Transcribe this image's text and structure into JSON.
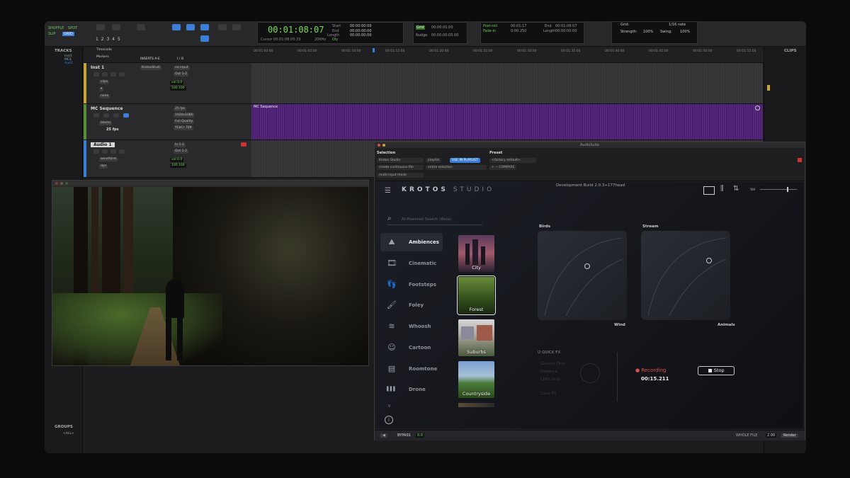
{
  "toolbar": {
    "mode": [
      "SHUFFLE",
      "SPOT",
      "SLIP",
      "GRID"
    ],
    "nums": "1 2 3 4 5",
    "main_counter": "00:01:08:07",
    "cursor_label": "Cursor",
    "cursor_value": "00:01:08:00.33",
    "sample_rate": "20KHz",
    "dly_label": "Dly",
    "start_label": "Start",
    "end_label": "End",
    "length_label": "Length",
    "start_value": "00:00:00:00",
    "end_value": "00:00:00:00",
    "length_value": "00:00:00:00",
    "grid_value": "00:00:01:00",
    "nudge_label": "Nudge",
    "nudge_value": "00:00:00:05.00",
    "preroll_label": "Post-roll",
    "fadein_label": "Fade-in",
    "pre_start": "00:01:17",
    "pre_end": "00:01:08:07",
    "post_value": "0:00.250",
    "strength_label": "Strength:",
    "strength_value": "100%",
    "swing_label": "Swing:",
    "swing_value": "100%",
    "grid_label": "Grid:",
    "grid_note": "1/16 note"
  },
  "tracks_panel": {
    "title": "TRACKS",
    "items": [
      "Inst1",
      "MC4",
      "Aud1"
    ],
    "groups_title": "GROUPS",
    "groups_all": "<ALL>"
  },
  "edit": {
    "timecode_label": "Timecode",
    "markers_label": "Markers",
    "inserts_label": "INSERTS A-E",
    "io_label": "I / O",
    "ruler": [
      "00:01:00:00",
      "00:01:05:00",
      "00:01:10:00",
      "00:01:15:00",
      "00:01:20:00",
      "00:01:25:00",
      "00:01:30:00",
      "00:01:35:00",
      "00:01:40:00",
      "00:01:45:00",
      "00:01:50:00",
      "00:01:55:00"
    ]
  },
  "tracks": [
    {
      "name": "Inst 1",
      "insert": "KrotosStudi",
      "input": "no input",
      "output": "Out 1-2",
      "view": "clips",
      "vol": "0.0",
      "pan": "100 100",
      "extra": "none"
    },
    {
      "name": "MC Sequence",
      "fps": "25 fps",
      "res": "1920x1080",
      "quality": "Full Quality",
      "format": "YCbCr 709",
      "view": "blocks",
      "fps_label": "25 fps"
    },
    {
      "name": "Audio 1",
      "input": "In 1-2",
      "output": "Out 1-2",
      "view": "waveform",
      "vol": "0.0",
      "pan": "100 100",
      "extra": "dyn"
    }
  ],
  "clip_label": "MC Sequence",
  "clips_panel": {
    "title": "CLIPS"
  },
  "audiosuite": {
    "title": "AudioSuite",
    "selection_label": "Selection",
    "preset_label": "Preset",
    "plugin": "Krotos Studio",
    "playlist": "playlist",
    "use_in_playlist": "USE IN PLAYLIST",
    "factory_default": "<factory default>",
    "create_continuous": "create continuous file",
    "entire_selection": "entire selection",
    "compare": "COMPARE",
    "multi_input": "multi-input mode",
    "bypass": "BYPASS",
    "handle_file": "WHOLE FILE",
    "handle_value": "2.00",
    "render": "Render",
    "bypass_val": "0.0"
  },
  "krotos": {
    "logo_bold": "KROTOS",
    "logo_thin": "STUDIO",
    "build": "Development Build 2.0.3+177head",
    "vol_label": "Vol",
    "search_placeholder": "AI-Powered Search (Beta)",
    "categories": [
      {
        "label": "Ambiences",
        "icon": "⛰"
      },
      {
        "label": "Cinematic",
        "icon": "🎞"
      },
      {
        "label": "Footsteps",
        "icon": "👣"
      },
      {
        "label": "Foley",
        "icon": "🖌"
      },
      {
        "label": "Whoosh",
        "icon": "≋"
      },
      {
        "label": "Cartoon",
        "icon": "☺"
      },
      {
        "label": "Roomtone",
        "icon": "▤"
      },
      {
        "label": "Drone",
        "icon": "▌▌▌"
      }
    ],
    "thumbnails": [
      "City",
      "Forest",
      "Suburbs",
      "Countryside"
    ],
    "xy1": {
      "top": "Birds",
      "bottom": "Wind"
    },
    "xy2": {
      "top": "Stream",
      "bottom": "Animals"
    },
    "quickfx": "QUICK FX",
    "qfx_items": [
      "Ghostly Only",
      "Distance",
      "Cliffs Only",
      "Cave FX"
    ],
    "recording_label": "Recording",
    "recording_time": "00:15.211",
    "stop_label": "Stop"
  },
  "colors": {
    "accent_green": "#7bdc5b",
    "accent_blue": "#3b7fd8",
    "purple_clip": "#4b2070",
    "recording_red": "#d9534f"
  }
}
